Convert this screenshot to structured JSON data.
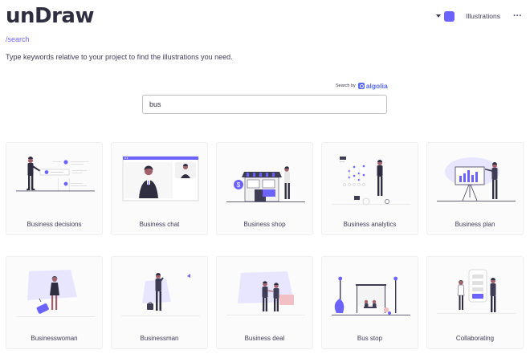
{
  "header": {
    "logo": "unDraw",
    "accent_color": "#6c63ff",
    "nav_link": "Illustrations",
    "more_icon": "more-horizontal-icon",
    "color_caret_icon": "caret-down-icon"
  },
  "route": "/search",
  "intro": "Type keywords relative to your project to find the illustrations you need.",
  "algolia": {
    "prefix": "Search by",
    "brand": "algolia"
  },
  "search": {
    "value": "bus",
    "placeholder": ""
  },
  "cards": [
    {
      "title": "Business decisions",
      "art": "business-decisions-illustration"
    },
    {
      "title": "Business chat",
      "art": "business-chat-illustration"
    },
    {
      "title": "Business shop",
      "art": "business-shop-illustration"
    },
    {
      "title": "Business analytics",
      "art": "business-analytics-illustration"
    },
    {
      "title": "Business plan",
      "art": "business-plan-illustration"
    },
    {
      "title": "Businesswoman",
      "art": "businesswoman-illustration"
    },
    {
      "title": "Businessman",
      "art": "businessman-illustration"
    },
    {
      "title": "Business deal",
      "art": "business-deal-illustration"
    },
    {
      "title": "Bus stop",
      "art": "bus-stop-illustration"
    },
    {
      "title": "Collaborating",
      "art": "collaborating-illustration"
    }
  ]
}
